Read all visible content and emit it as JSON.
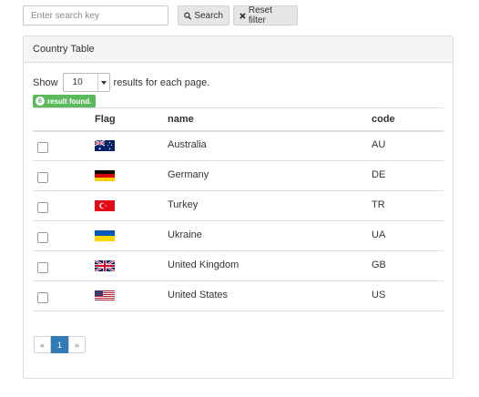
{
  "search": {
    "placeholder": "Enter search key"
  },
  "toolbar": {
    "search_label": "Search",
    "reset_label": "Reset filter"
  },
  "panel": {
    "title": "Country Table"
  },
  "paging": {
    "show_label": "Show",
    "page_size": "10",
    "suffix_label": "results for each page.",
    "found_count": "6",
    "found_label": "result found."
  },
  "table": {
    "headers": {
      "flag": "Flag",
      "name": "name",
      "code": "code"
    },
    "rows": [
      {
        "flag_icon": "australia-flag-icon",
        "name": "Australia",
        "code": "AU"
      },
      {
        "flag_icon": "germany-flag-icon",
        "name": "Germany",
        "code": "DE"
      },
      {
        "flag_icon": "turkey-flag-icon",
        "name": "Turkey",
        "code": "TR"
      },
      {
        "flag_icon": "ukraine-flag-icon",
        "name": "Ukraine",
        "code": "UA"
      },
      {
        "flag_icon": "united-kingdom-flag-icon",
        "name": "United Kingdom",
        "code": "GB"
      },
      {
        "flag_icon": "united-states-flag-icon",
        "name": "United States",
        "code": "US"
      }
    ]
  },
  "pagination": {
    "prev": "«",
    "current": "1",
    "next": "»"
  },
  "colors": {
    "accent": "#337ab7",
    "badge": "#5cb85c",
    "border": "#dcdcdc"
  }
}
